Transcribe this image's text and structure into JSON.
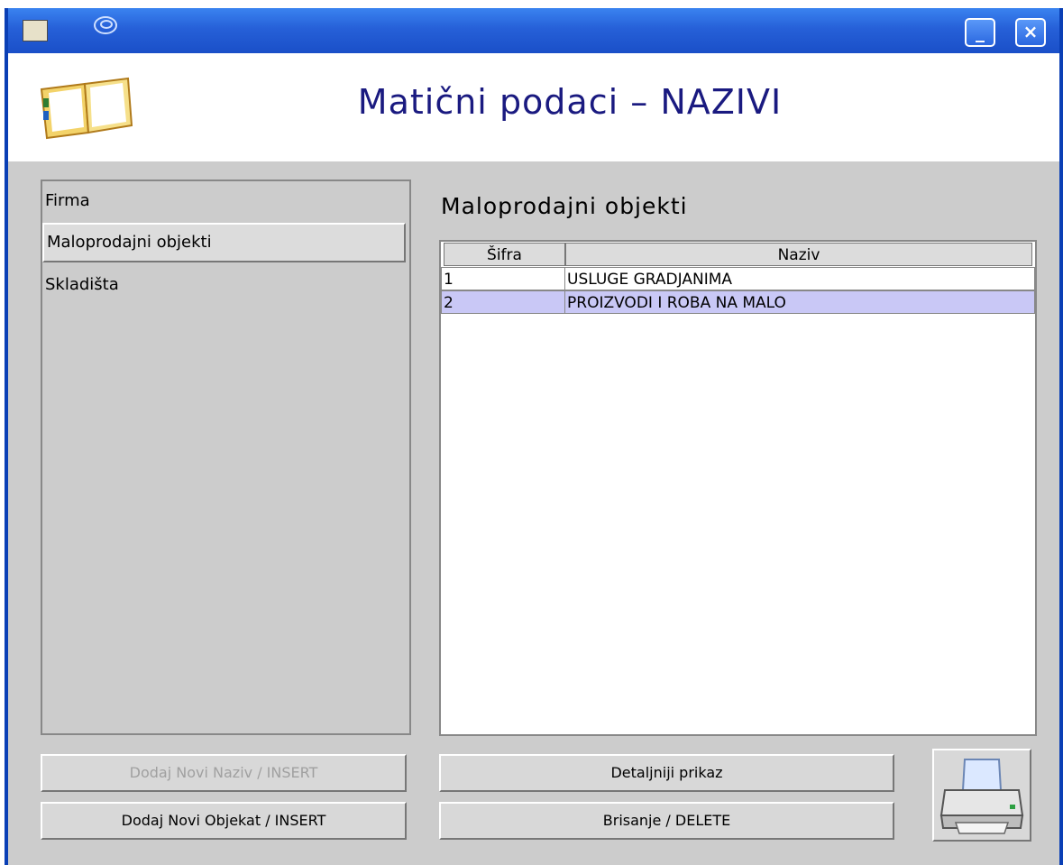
{
  "titlebar": {
    "minimize_label": "_",
    "close_label": "×",
    "icons": [
      "app-icon",
      "swirl-icon"
    ]
  },
  "header": {
    "title": "Matični podaci – NAZIVI",
    "icon": "book-icon"
  },
  "sidebar": {
    "items": [
      {
        "label": "Firma"
      },
      {
        "label": "Maloprodajni objekti"
      },
      {
        "label": "Skladišta"
      }
    ]
  },
  "main": {
    "section_title": "Maloprodajni objekti",
    "table": {
      "columns": [
        "Šifra",
        "Naziv"
      ],
      "rows": [
        {
          "sifra": "1",
          "naziv": "USLUGE GRADJANIMA"
        },
        {
          "sifra": "2",
          "naziv": "PROIZVODI I ROBA NA MALO"
        }
      ]
    }
  },
  "buttons": {
    "dodaj_naziv": "Dodaj Novi Naziv / INSERT",
    "dodaj_objekat": "Dodaj Novi Objekat / INSERT",
    "detaljniji": "Detaljniji prikaz",
    "brisanje": "Brisanje / DELETE",
    "print_icon": "printer-icon"
  },
  "colors": {
    "titlebar": "#2660d8",
    "selection": "#c9c8f6",
    "title_text": "#1a1a80"
  }
}
